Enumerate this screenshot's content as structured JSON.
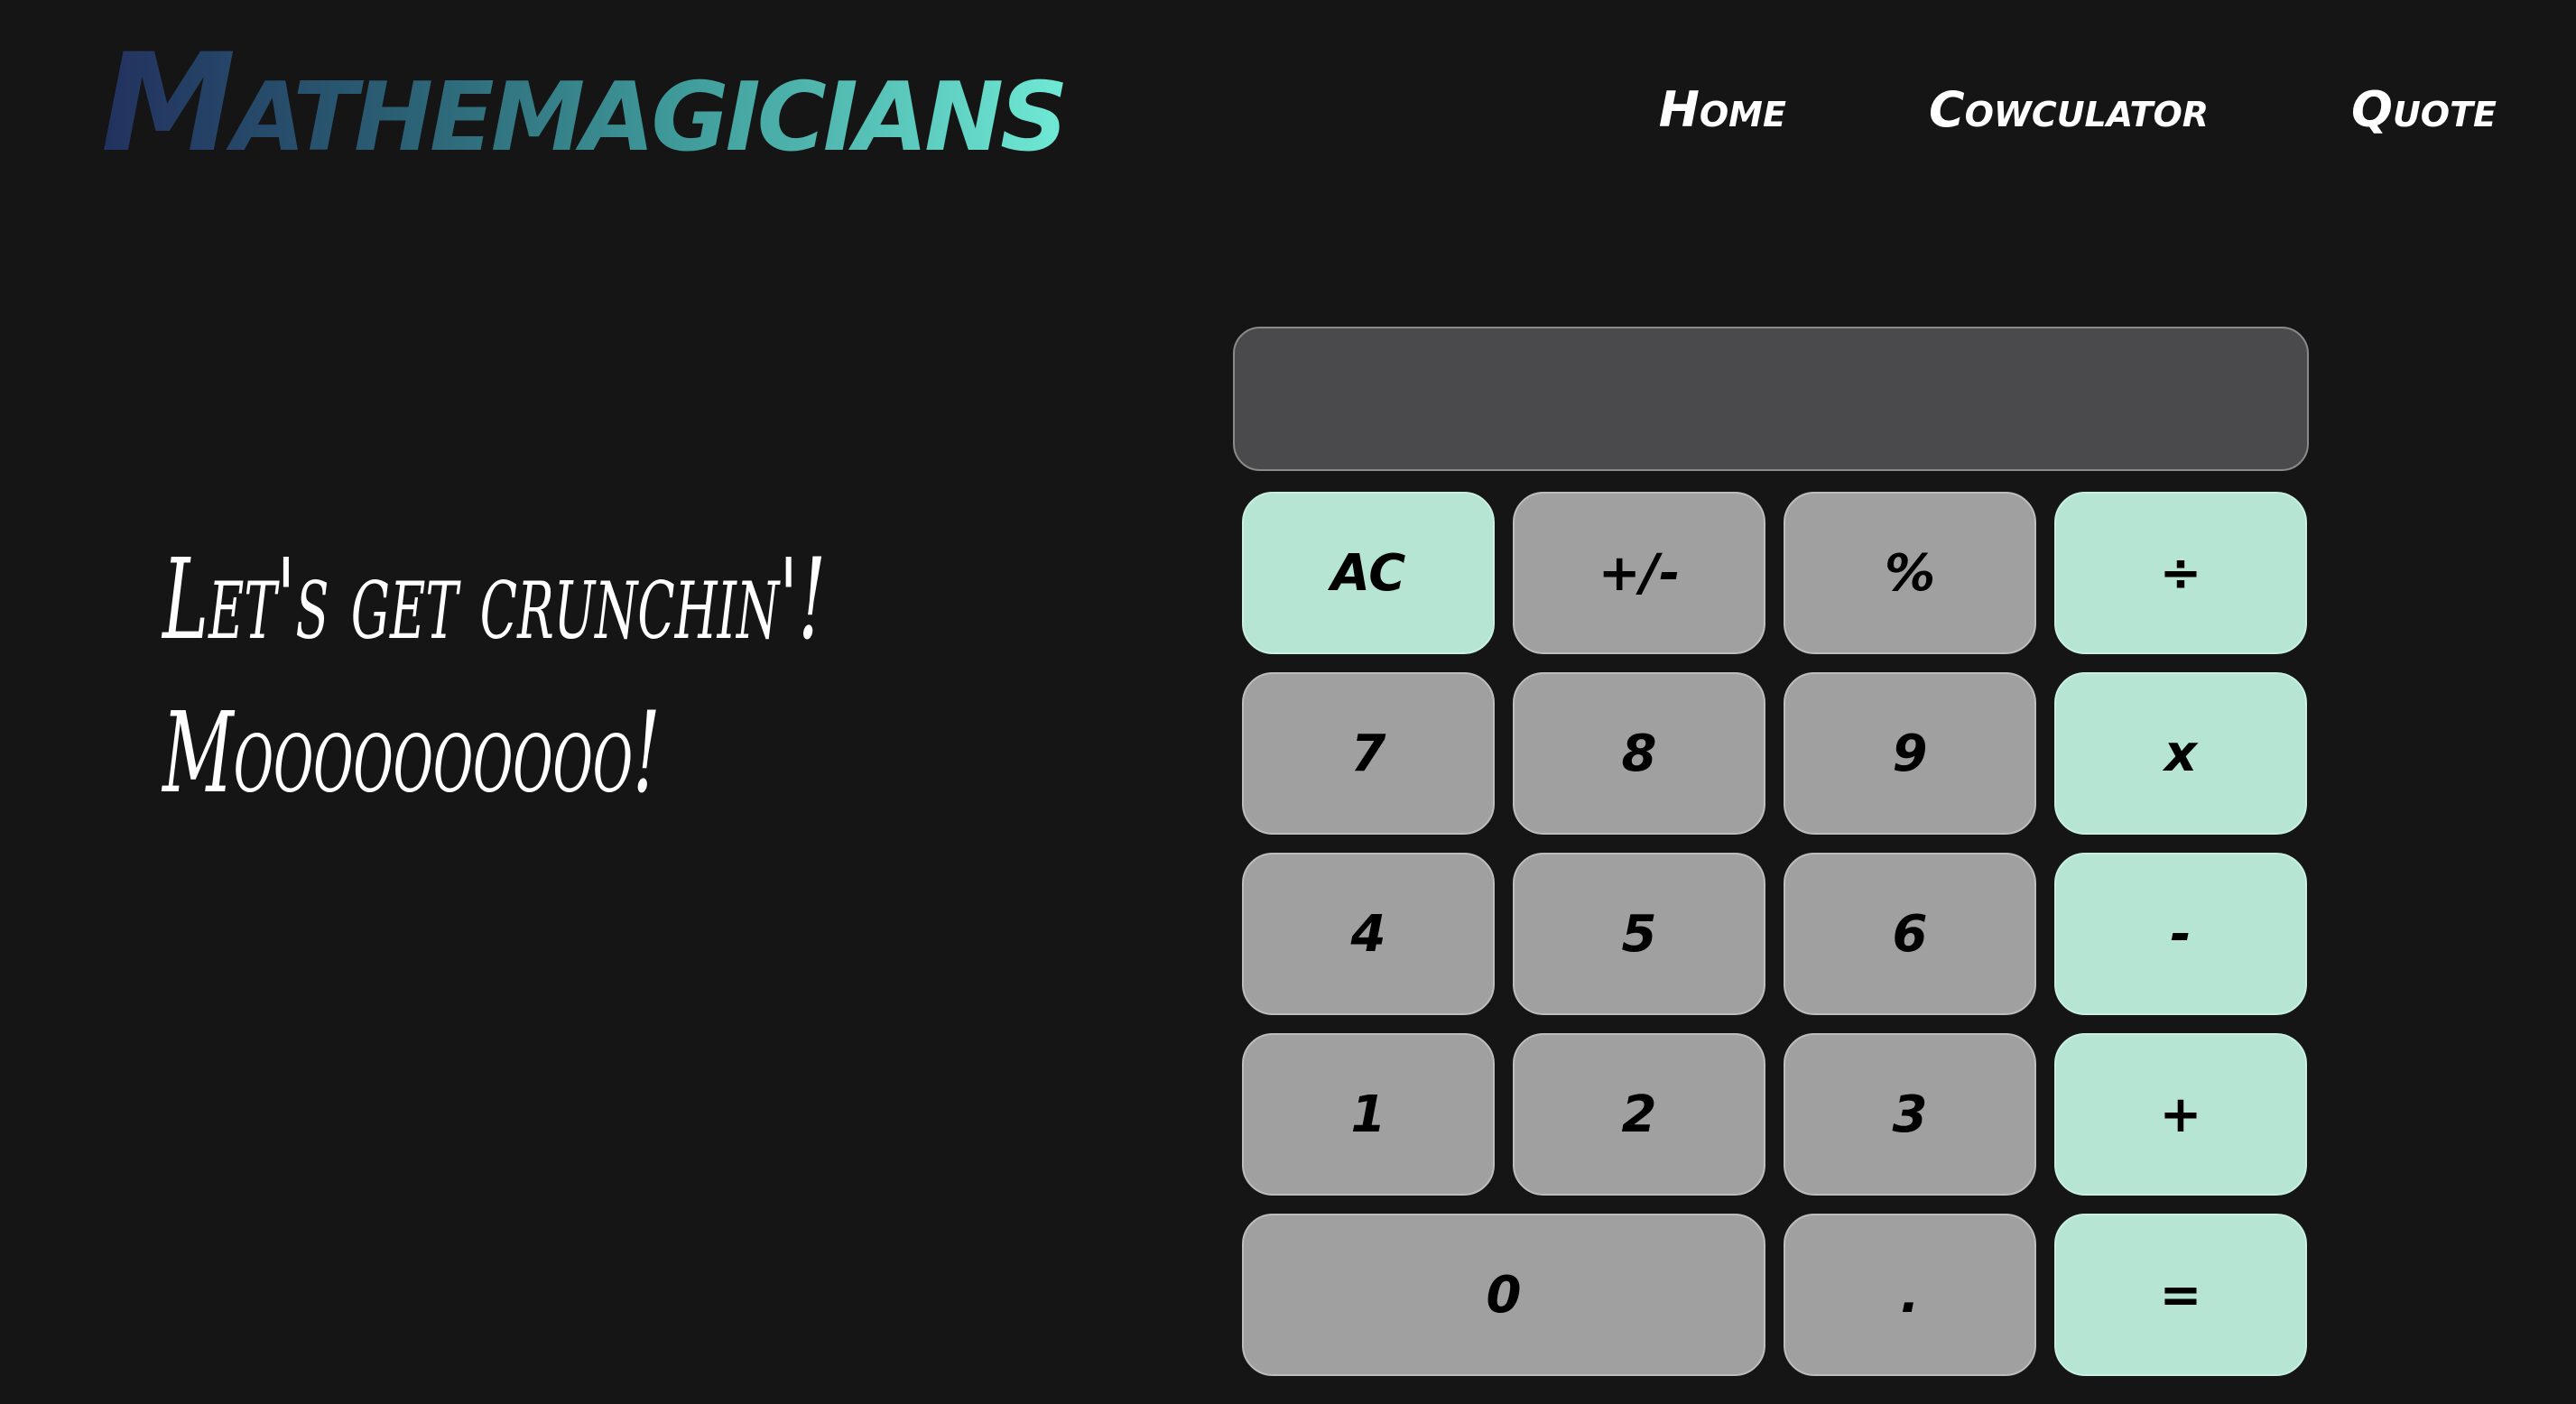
{
  "header": {
    "logo": "Mathemagicians",
    "nav": {
      "home": "Home",
      "calculator": "Cowculator",
      "quote": "Quote"
    }
  },
  "tagline": {
    "line1": "Let's get crunchin'!",
    "line2": "Moooooooooo!"
  },
  "calculator": {
    "display_value": "",
    "keys": {
      "ac": "AC",
      "sign": "+/-",
      "percent": "%",
      "divide": "÷",
      "seven": "7",
      "eight": "8",
      "nine": "9",
      "multiply": "x",
      "four": "4",
      "five": "5",
      "six": "6",
      "minus": "-",
      "one": "1",
      "two": "2",
      "three": "3",
      "plus": "+",
      "zero": "0",
      "decimal": ".",
      "equals": "="
    }
  },
  "colors": {
    "background": "#151515",
    "accent_key": "#b6e5d4",
    "number_key": "#a0a0a0",
    "display": "#4a4a4c",
    "logo_gradient_start": "#22315e",
    "logo_gradient_end": "#6fe9d5"
  }
}
